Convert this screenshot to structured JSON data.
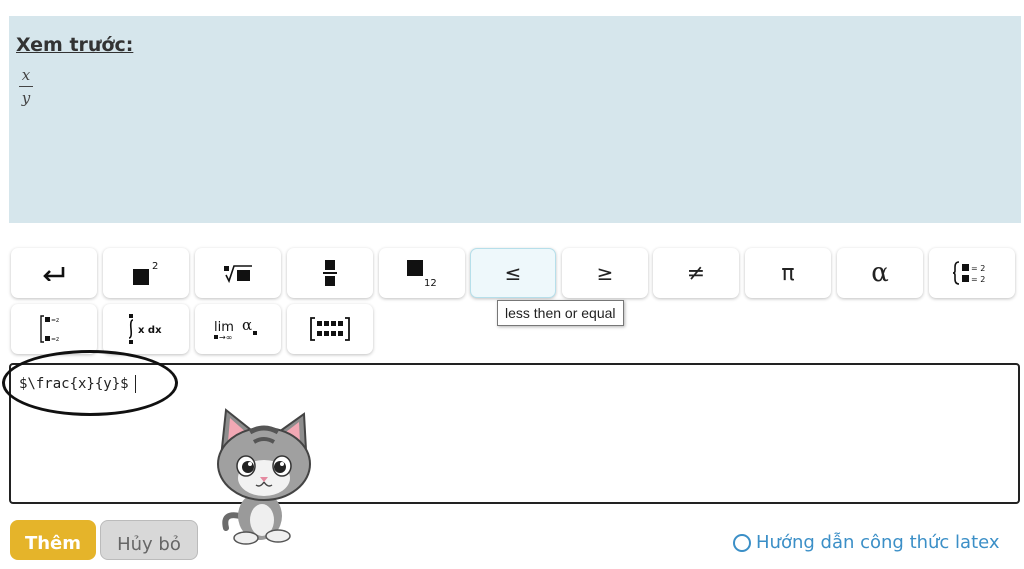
{
  "preview": {
    "title": "Xem trước:",
    "fraction": {
      "numerator": "x",
      "denominator": "y"
    }
  },
  "toolbar": {
    "symbols": {
      "leq": "≤",
      "geq": "≥",
      "neq": "≠",
      "pi": "π",
      "alpha": "α"
    },
    "tooltip": "less then or equal",
    "icons": [
      "enter-icon",
      "superscript-icon",
      "nth-root-icon",
      "fraction-icon",
      "subscript-icon",
      "cases-icon",
      "bracket-matrix-icon",
      "integral-icon",
      "limit-icon",
      "matrix-icon"
    ]
  },
  "editor": {
    "value": "$\\frac{x}{y}$"
  },
  "buttons": {
    "add_label": "Thêm",
    "cancel_label": "Hủy bỏ"
  },
  "help": {
    "label": "Hướng dẫn công thức latex"
  },
  "colors": {
    "preview_bg": "#d6e6ec",
    "add_button": "#e5b42a",
    "cancel_button": "#d8d8d8",
    "link": "#3b8fc7",
    "tooltip_hover_bg": "#eef8fb"
  }
}
